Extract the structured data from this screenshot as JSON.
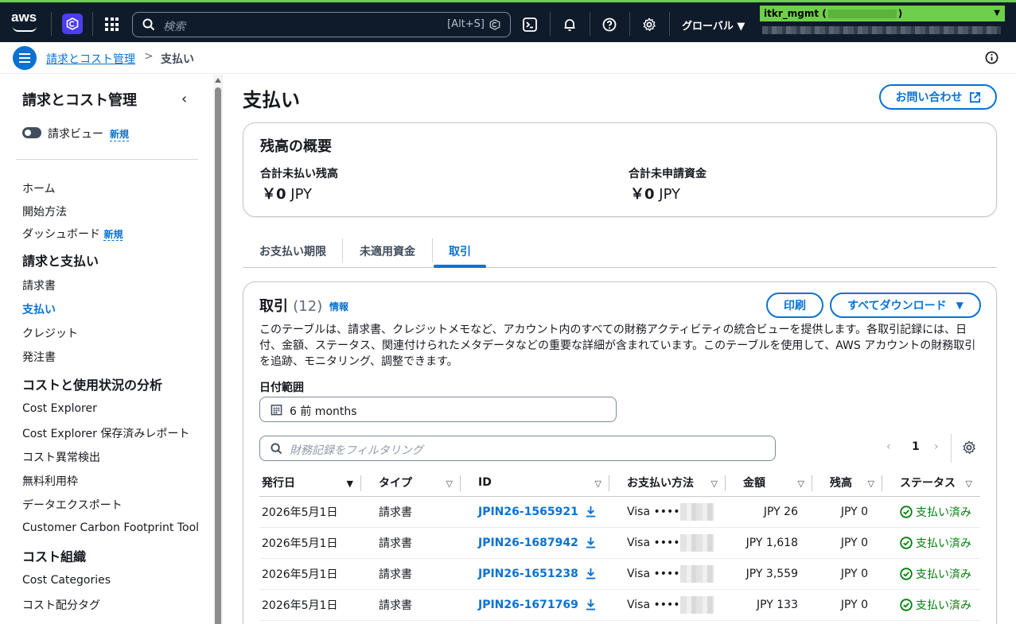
{
  "topnav": {
    "logo_text": "aws",
    "search_placeholder": "検索",
    "search_shortcut": "[Alt+S]",
    "region": "グローバル ▼",
    "account_prefix": "itkr_mgmt (",
    "account_suffix": ")",
    "colors": {
      "bar": "#0f1b2a",
      "account": "#6ecf4a",
      "service": "#4b3df2"
    }
  },
  "breadcrumb": {
    "parent": "請求とコスト管理",
    "current": "支払い"
  },
  "sidebar": {
    "title": "請求とコスト管理",
    "billing_view_label": "請求ビュー",
    "new_badge": "新規",
    "items": {
      "home": "ホーム",
      "getting_started": "開始方法",
      "dashboard": "ダッシュボード",
      "billing_head": "請求と支払い",
      "bills": "請求書",
      "payments": "支払い",
      "credits": "クレジット",
      "purchase_orders": "発注書",
      "cost_head": "コストと使用状況の分析",
      "cost_explorer": "Cost Explorer",
      "cost_explorer_saved": "Cost Explorer 保存済みレポート",
      "anomaly": "コスト異常検出",
      "free_tier": "無料利用枠",
      "data_exports": "データエクスポート",
      "carbon": "Customer Carbon Footprint Tool",
      "org_head": "コスト組織",
      "cost_categories": "Cost Categories",
      "cost_alloc_tags": "コスト配分タグ"
    }
  },
  "main": {
    "title": "支払い",
    "contact_button": "お問い合わせ",
    "summary": {
      "heading": "残高の概要",
      "unpaid_label": "合計未払い残高",
      "unpaid_currency": "￥",
      "unpaid_amount": "0",
      "unpaid_unit": "JPY",
      "unapplied_label": "合計未申請資金",
      "unapplied_currency": "￥",
      "unapplied_amount": "0",
      "unapplied_unit": "JPY"
    },
    "tabs": [
      "お支払い期限",
      "未適用資金",
      "取引"
    ],
    "transactions": {
      "heading": "取引",
      "count": "(12)",
      "info": "情報",
      "print_button": "印刷",
      "download_button": "すべてダウンロード",
      "description": "このテーブルは、請求書、クレジットメモなど、アカウント内のすべての財務アクティビティの統合ビューを提供します。各取引記録には、日付、金額、ステータス、関連付けられたメタデータなどの重要な詳細が含まれています。このテーブルを使用して、AWS アカウントの財務取引を追跡、モニタリング、調整できます。",
      "date_range_label": "日付範囲",
      "date_range_value": "6 前 months",
      "filter_placeholder": "財務記録をフィルタリング",
      "page": "1",
      "columns": [
        "発行日",
        "タイプ",
        "ID",
        "お支払い方法",
        "金額",
        "残高",
        "ステータス"
      ],
      "rows": [
        {
          "date": "2026年5月1日",
          "type": "請求書",
          "id": "JPIN26-1565921",
          "method": "Visa ••••",
          "amount": "JPY 26",
          "balance": "JPY 0",
          "status": "支払い済み"
        },
        {
          "date": "2026年5月1日",
          "type": "請求書",
          "id": "JPIN26-1687942",
          "method": "Visa ••••",
          "amount": "JPY 1,618",
          "balance": "JPY 0",
          "status": "支払い済み"
        },
        {
          "date": "2026年5月1日",
          "type": "請求書",
          "id": "JPIN26-1651238",
          "method": "Visa ••••",
          "amount": "JPY 3,559",
          "balance": "JPY 0",
          "status": "支払い済み"
        },
        {
          "date": "2026年5月1日",
          "type": "請求書",
          "id": "JPIN26-1671769",
          "method": "Visa ••••",
          "amount": "JPY 133",
          "balance": "JPY 0",
          "status": "支払い済み"
        }
      ]
    }
  }
}
